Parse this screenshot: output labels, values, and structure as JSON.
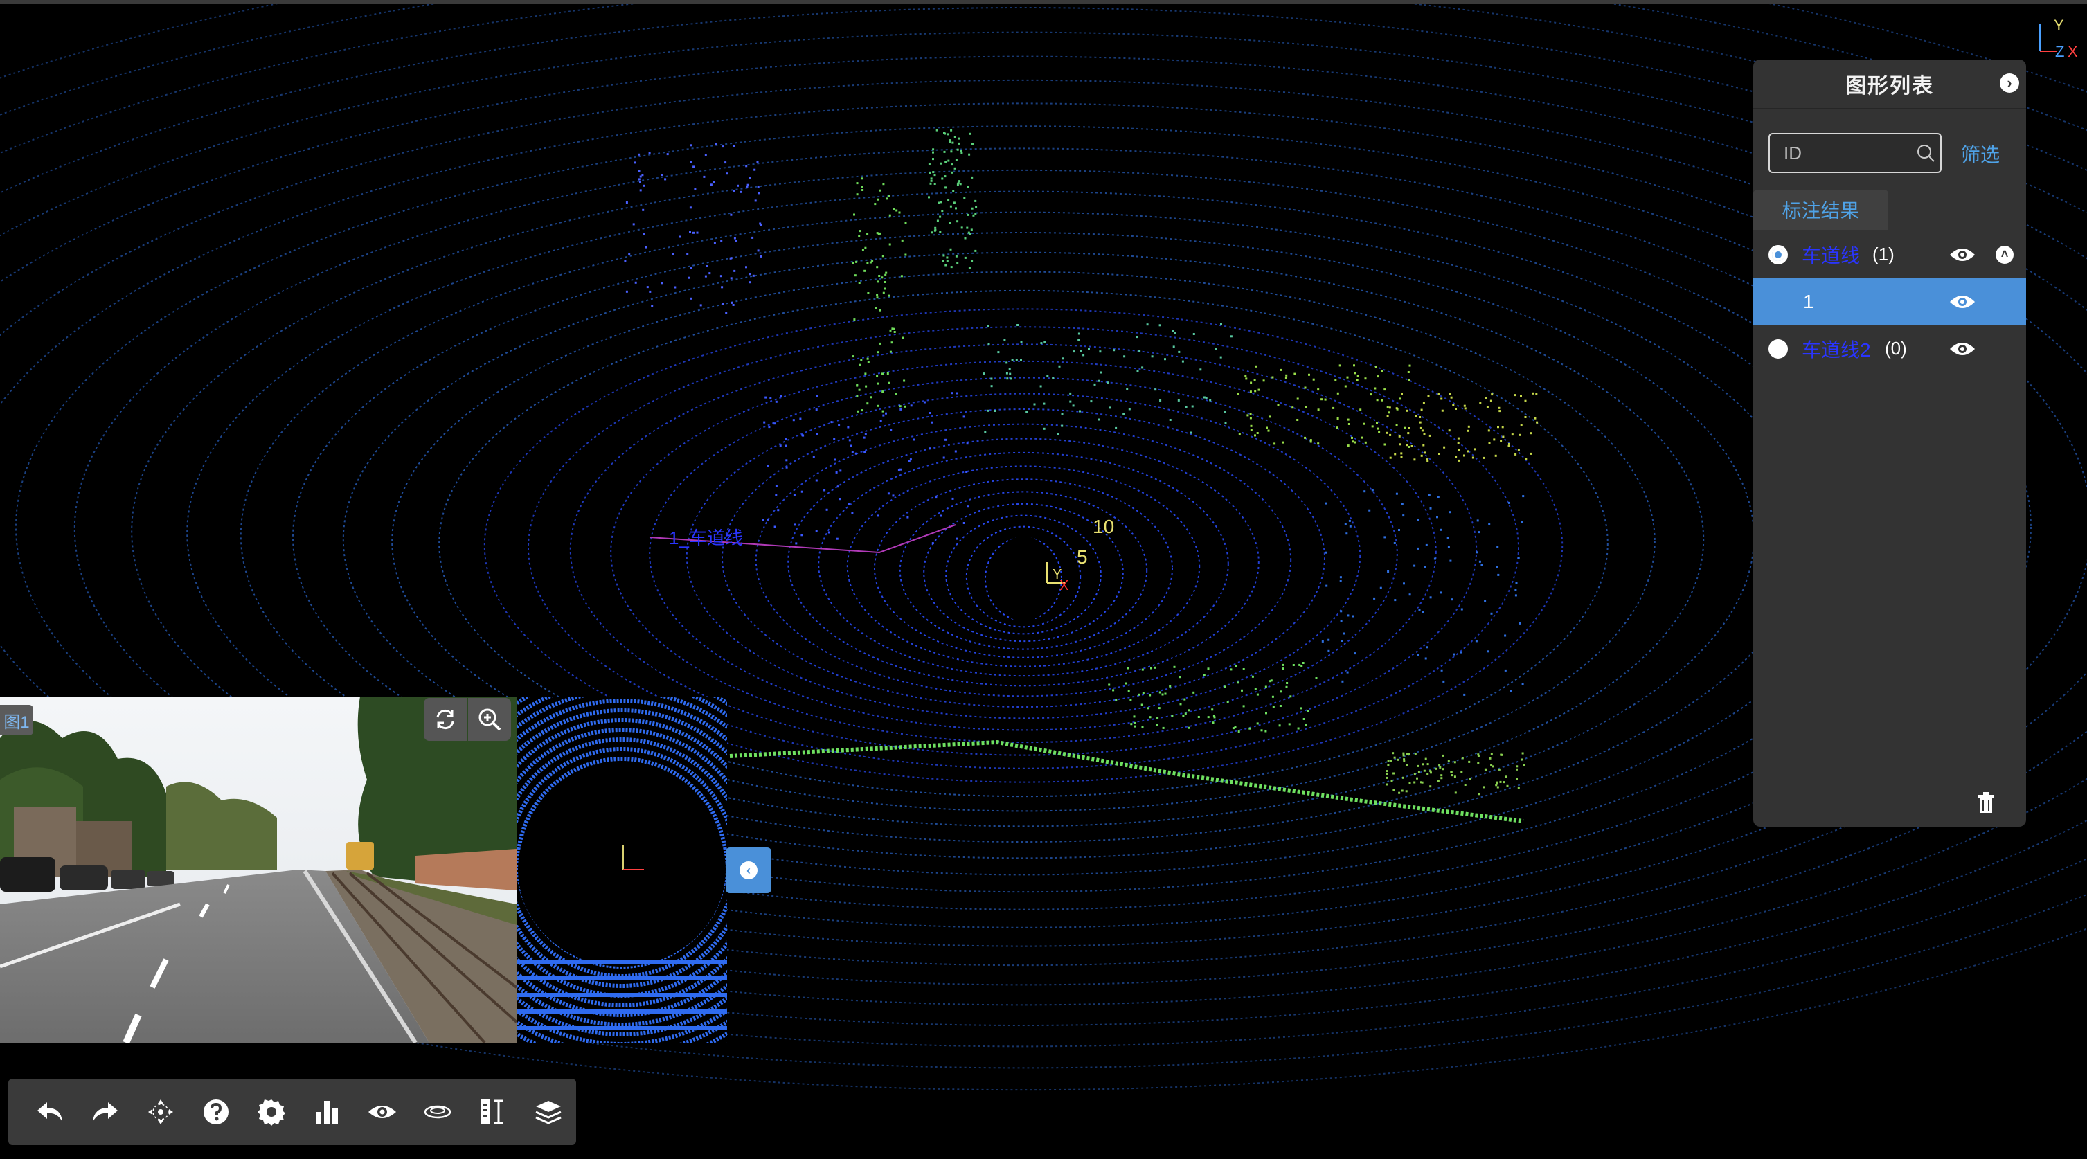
{
  "viewport": {
    "axis_x": "X",
    "axis_y": "Y",
    "axis_z": "Z",
    "ring_label_10": "10",
    "ring_label_5": "5",
    "origin_x": "X",
    "origin_y": "Y",
    "annotation_label": "1_车道线"
  },
  "panel": {
    "title": "图形列表",
    "search_placeholder": "ID",
    "filter_label": "筛选",
    "tab_label": "标注结果",
    "categories": [
      {
        "name": "车道线",
        "count": "(1)",
        "checked": true,
        "items": [
          {
            "id": "1"
          }
        ]
      },
      {
        "name": "车道线2",
        "count": "(0)",
        "checked": false,
        "items": []
      }
    ]
  },
  "camera": {
    "label": "图1"
  },
  "toolbar": {
    "tools": [
      "undo-icon",
      "redo-icon",
      "move-icon",
      "help-icon",
      "settings-icon",
      "chart-icon",
      "eye-icon",
      "ring-icon",
      "ruler-icon",
      "layers-icon"
    ]
  },
  "colors": {
    "accent": "#4a90d9",
    "category": "#2a35ff",
    "panel_bg": "#333333"
  }
}
